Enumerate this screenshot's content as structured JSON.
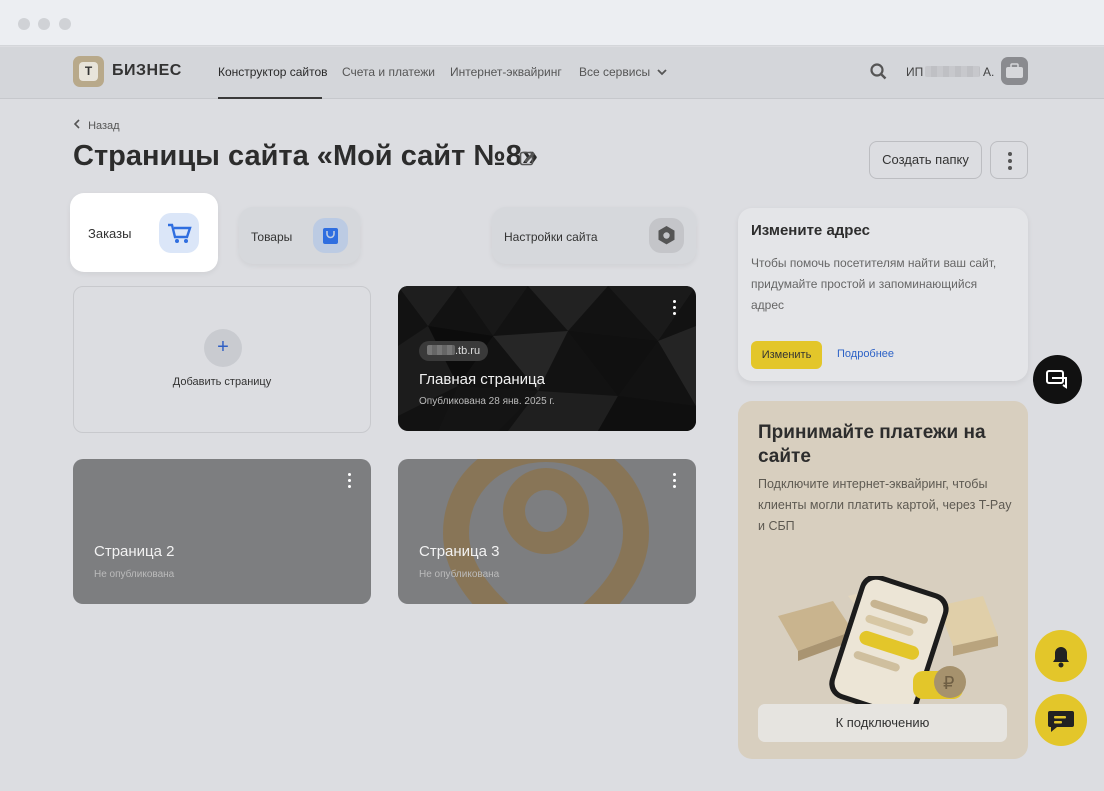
{
  "window": {
    "dots": 3
  },
  "nav": {
    "brand": "БИЗНЕС",
    "brand_badge": "Т",
    "links": [
      {
        "label": "Конструктор сайтов",
        "active": true
      },
      {
        "label": "Счета и платежи",
        "active": false
      },
      {
        "label": "Интернет-эквайринг",
        "active": false
      },
      {
        "label": "Все сервисы",
        "active": false
      }
    ],
    "user_prefix": "ИП",
    "user_suffix": "А."
  },
  "header": {
    "back_label": "Назад",
    "title": "Страницы сайта «Мой сайт №8»",
    "create_folder_label": "Создать папку"
  },
  "tiles": {
    "orders": "Заказы",
    "products": "Товары",
    "settings": "Настройки сайта"
  },
  "pages": {
    "add_label": "Добавить страницу",
    "items": [
      {
        "domain_suffix": ".tb.ru",
        "title": "Главная страница",
        "status": "Опубликована 28 янв. 2025 г."
      },
      {
        "title": "Страница 2",
        "status": "Не опубликована"
      },
      {
        "title": "Страница 3",
        "status": "Не опубликована"
      }
    ]
  },
  "address_card": {
    "title": "Измените адрес",
    "text": "Чтобы помочь посетителям найти ваш сайт, придумайте простой и запоминающийся адрес",
    "change_label": "Изменить",
    "more_label": "Подробнее"
  },
  "payments_card": {
    "title": "Принимайте платежи на сайте",
    "text": "Подключите интернет-эквайринг, чтобы клиенты могли платить картой, через T-Pay и СБП",
    "button_label": "К подключению"
  },
  "colors": {
    "accent_yellow": "#e3c62a",
    "link_blue": "#2d62c6",
    "background": "#dcdde1"
  }
}
